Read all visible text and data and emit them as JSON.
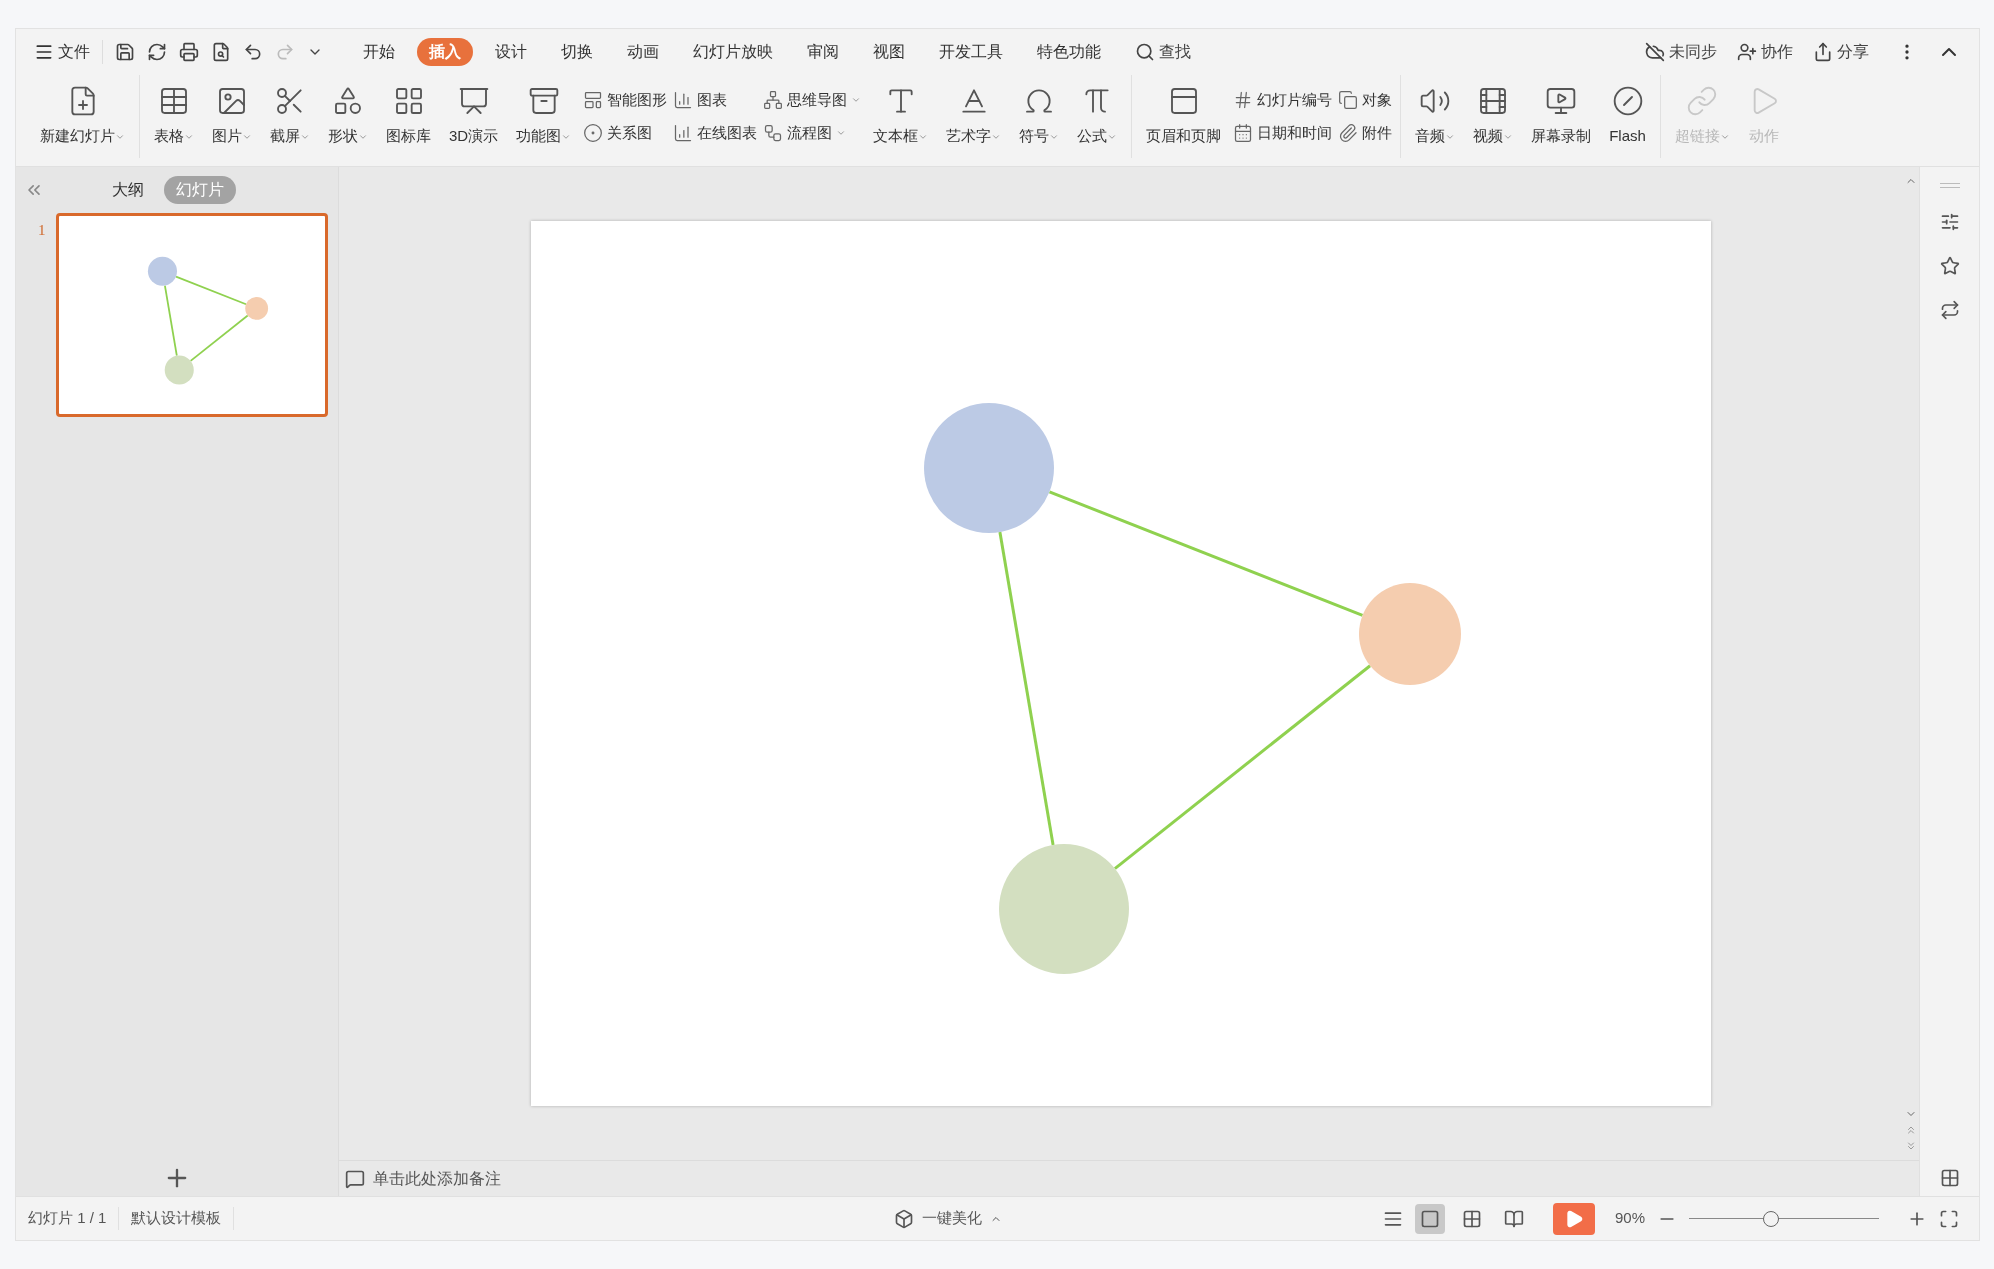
{
  "menu": {
    "file": "文件",
    "tabs": [
      {
        "label": "开始",
        "selected": false
      },
      {
        "label": "插入",
        "selected": true
      },
      {
        "label": "设计",
        "selected": false
      },
      {
        "label": "切换",
        "selected": false
      },
      {
        "label": "动画",
        "selected": false
      },
      {
        "label": "幻灯片放映",
        "selected": false
      },
      {
        "label": "审阅",
        "selected": false
      },
      {
        "label": "视图",
        "selected": false
      },
      {
        "label": "开发工具",
        "selected": false
      },
      {
        "label": "特色功能",
        "selected": false
      }
    ],
    "search": "查找",
    "actions": [
      "未同步",
      "协作",
      "分享"
    ]
  },
  "ribbon": [
    [
      {
        "kind": "big",
        "label": "新建幻灯片",
        "dropdown": true,
        "disabled": false
      }
    ],
    [
      {
        "kind": "big",
        "label": "表格",
        "dropdown": true,
        "disabled": false
      },
      {
        "kind": "big",
        "label": "图片",
        "dropdown": true,
        "disabled": false
      },
      {
        "kind": "big",
        "label": "截屏",
        "dropdown": true,
        "disabled": false
      },
      {
        "kind": "big",
        "label": "形状",
        "dropdown": true,
        "disabled": false
      },
      {
        "kind": "big",
        "label": "图标库",
        "dropdown": false,
        "disabled": false
      },
      {
        "kind": "big",
        "label": "3D演示",
        "dropdown": false,
        "disabled": false
      },
      {
        "kind": "big",
        "label": "功能图",
        "dropdown": true,
        "disabled": false
      },
      {
        "kind": "pair",
        "items": [
          {
            "label": "智能图形",
            "dropdown": false
          },
          {
            "label": "关系图",
            "dropdown": false
          }
        ]
      },
      {
        "kind": "pair",
        "items": [
          {
            "label": "图表",
            "dropdown": false
          },
          {
            "label": "在线图表",
            "dropdown": false
          }
        ]
      },
      {
        "kind": "pair",
        "items": [
          {
            "label": "思维导图",
            "dropdown": true
          },
          {
            "label": "流程图",
            "dropdown": true
          }
        ]
      },
      {
        "kind": "big",
        "label": "文本框",
        "dropdown": true,
        "disabled": false
      },
      {
        "kind": "big",
        "label": "艺术字",
        "dropdown": true,
        "disabled": false
      },
      {
        "kind": "big",
        "label": "符号",
        "dropdown": true,
        "disabled": false
      },
      {
        "kind": "big",
        "label": "公式",
        "dropdown": true,
        "disabled": false
      }
    ],
    [
      {
        "kind": "big",
        "label": "页眉和页脚",
        "dropdown": false,
        "disabled": false
      },
      {
        "kind": "pair",
        "items": [
          {
            "label": "幻灯片编号",
            "dropdown": false
          },
          {
            "label": "日期和时间",
            "dropdown": false
          }
        ]
      },
      {
        "kind": "pair",
        "items": [
          {
            "label": "对象",
            "dropdown": false
          },
          {
            "label": "附件",
            "dropdown": false
          }
        ]
      }
    ],
    [
      {
        "kind": "big",
        "label": "音频",
        "dropdown": true,
        "disabled": false
      },
      {
        "kind": "big",
        "label": "视频",
        "dropdown": true,
        "disabled": false
      },
      {
        "kind": "big",
        "label": "屏幕录制",
        "dropdown": false,
        "disabled": false
      },
      {
        "kind": "big",
        "label": "Flash",
        "dropdown": false,
        "disabled": false
      }
    ],
    [
      {
        "kind": "big",
        "label": "超链接",
        "dropdown": true,
        "disabled": true
      },
      {
        "kind": "big",
        "label": "动作",
        "dropdown": false,
        "disabled": true
      }
    ]
  ],
  "panel": {
    "tabs": [
      {
        "label": "大纲",
        "selected": false
      },
      {
        "label": "幻灯片",
        "selected": true
      }
    ],
    "slides": [
      {
        "number": "1",
        "selected": true
      }
    ]
  },
  "slide": {
    "nodes": [
      {
        "color": "#bccae5"
      },
      {
        "color": "#f5cdaf"
      },
      {
        "color": "#d3dfc0"
      }
    ]
  },
  "notes": {
    "placeholder": "单击此处添加备注"
  },
  "status_bar": {
    "slide_count": "幻灯片 1 / 1",
    "template": "默认设计模板",
    "beautify": "一键美化",
    "views": [
      {
        "selected": true
      },
      {
        "selected": false
      },
      {
        "selected": false
      }
    ],
    "zoom": "90%",
    "zoom_level": {
      "level": 0.43
    }
  }
}
